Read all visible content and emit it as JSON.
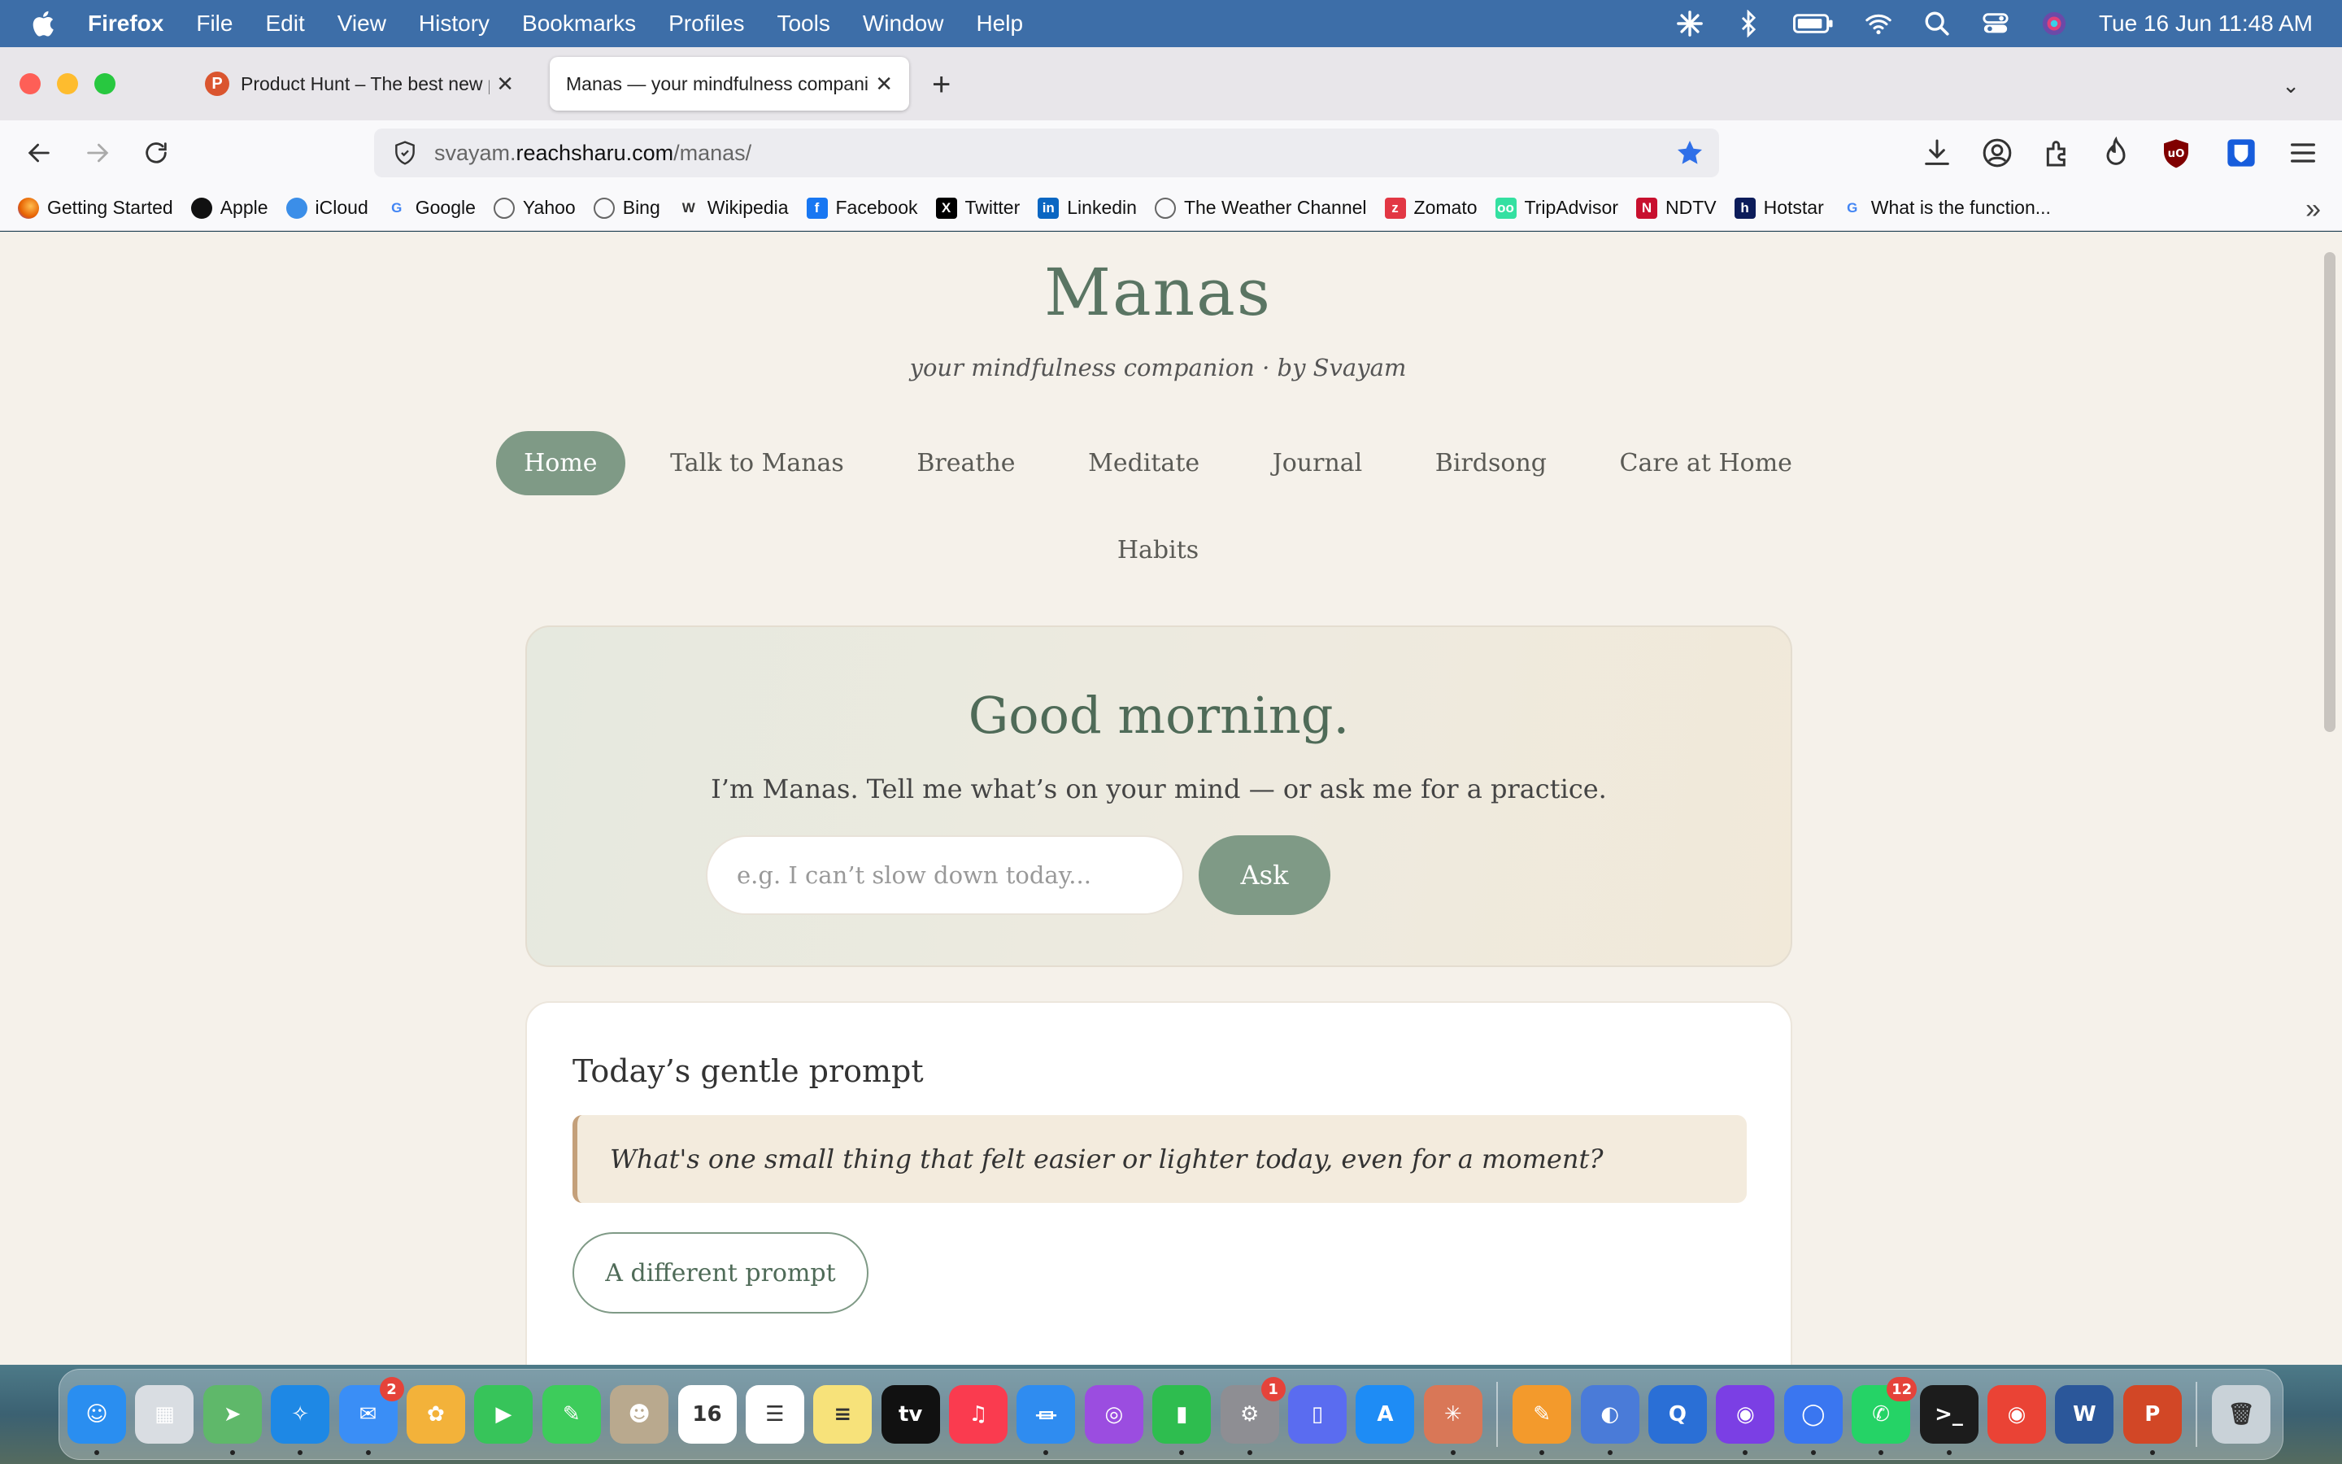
{
  "menubar": {
    "app": "Firefox",
    "items": [
      "File",
      "Edit",
      "View",
      "History",
      "Bookmarks",
      "Profiles",
      "Tools",
      "Window",
      "Help"
    ],
    "datetime": "Tue 16 Jun  11:48 AM"
  },
  "tabs": [
    {
      "title": "Product Hunt – The best new pr",
      "favicon": "P"
    },
    {
      "title": "Manas — your mindfulness compani"
    }
  ],
  "url": {
    "prefix": "svayam.",
    "host": "reachsharu.com",
    "path": "/manas/"
  },
  "bookmarks": [
    {
      "label": "Getting Started",
      "icon": "firefox-icon",
      "color": "#e66000",
      "glyph": ""
    },
    {
      "label": "Apple",
      "icon": "apple-icon",
      "color": "#111111",
      "glyph": ""
    },
    {
      "label": "iCloud",
      "icon": "cloud-icon",
      "color": "#3b8ee8",
      "glyph": ""
    },
    {
      "label": "Google",
      "icon": "google-icon",
      "color": "#4285f4",
      "glyph": "G"
    },
    {
      "label": "Yahoo",
      "icon": "globe-icon",
      "color": "#666666",
      "glyph": ""
    },
    {
      "label": "Bing",
      "icon": "globe-icon",
      "color": "#666666",
      "glyph": ""
    },
    {
      "label": "Wikipedia",
      "icon": "wikipedia-icon",
      "color": "#333333",
      "glyph": "W"
    },
    {
      "label": "Facebook",
      "icon": "facebook-icon",
      "color": "#1877f2",
      "glyph": "f"
    },
    {
      "label": "Twitter",
      "icon": "x-icon",
      "color": "#000000",
      "glyph": "X"
    },
    {
      "label": "Linkedin",
      "icon": "linkedin-icon",
      "color": "#0a66c2",
      "glyph": "in"
    },
    {
      "label": "The Weather Channel",
      "icon": "globe-icon",
      "color": "#666666",
      "glyph": ""
    },
    {
      "label": "Zomato",
      "icon": "zomato-icon",
      "color": "#e23744",
      "glyph": "z"
    },
    {
      "label": "TripAdvisor",
      "icon": "tripadvisor-icon",
      "color": "#34e0a1",
      "glyph": "oo"
    },
    {
      "label": "NDTV",
      "icon": "ndtv-icon",
      "color": "#c8102e",
      "glyph": "N"
    },
    {
      "label": "Hotstar",
      "icon": "hotstar-icon",
      "color": "#0c1c5a",
      "glyph": "h"
    },
    {
      "label": "What is the function...",
      "icon": "google-icon",
      "color": "#4285f4",
      "glyph": "G"
    }
  ],
  "site": {
    "brand": "Manas",
    "tagline": "your mindfulness companion · by Svayam",
    "nav": [
      "Home",
      "Talk to Manas",
      "Breathe",
      "Meditate",
      "Journal",
      "Birdsong",
      "Care at Home"
    ],
    "nav_row2": "Habits",
    "hero": {
      "greeting": "Good morning.",
      "subtitle": "I’m Manas. Tell me what’s on your mind — or ask me for a practice.",
      "input_placeholder": "e.g. I can’t slow down today...",
      "ask_label": "Ask"
    },
    "prompt": {
      "heading": "Today’s gentle prompt",
      "text": "What's one small thing that felt easier or lighter today, even for a moment?",
      "button_label": "A different prompt"
    }
  },
  "dock": [
    {
      "name": "finder-icon",
      "color": "#2a8ef0",
      "glyph": "☺",
      "dot": true
    },
    {
      "name": "launchpad-icon",
      "color": "#d9dde2",
      "glyph": "▦"
    },
    {
      "name": "maps-icon",
      "color": "#5fb86a",
      "glyph": "➤",
      "dot": true
    },
    {
      "name": "safari-icon",
      "color": "#1e88e5",
      "glyph": "✧",
      "dot": true
    },
    {
      "name": "mail-icon",
      "color": "#3a8ef6",
      "glyph": "✉",
      "dot": true,
      "badge": "2"
    },
    {
      "name": "photos-icon",
      "color": "#f3b23a",
      "glyph": "✿"
    },
    {
      "name": "facetime-icon",
      "color": "#37c45a",
      "glyph": "▶"
    },
    {
      "name": "messages-icon",
      "color": "#3dcc5b",
      "glyph": "✎"
    },
    {
      "name": "contacts-icon",
      "color": "#b9a98e",
      "glyph": "☻"
    },
    {
      "name": "calendar-icon",
      "color": "#ffffff",
      "glyph": "16",
      "dark": true
    },
    {
      "name": "reminders-icon",
      "color": "#ffffff",
      "glyph": "☰",
      "dark": true
    },
    {
      "name": "notes-icon",
      "color": "#f7e27a",
      "glyph": "≡",
      "dark": true
    },
    {
      "name": "apple-tv-icon",
      "color": "#111111",
      "glyph": "tv"
    },
    {
      "name": "music-icon",
      "color": "#fa3b4f",
      "glyph": "♫"
    },
    {
      "name": "keynote-icon",
      "color": "#2f8cf0",
      "glyph": "⏛",
      "dot": true
    },
    {
      "name": "podcasts-icon",
      "color": "#9b4de0",
      "glyph": "◎"
    },
    {
      "name": "numbers-icon",
      "color": "#2ebd4f",
      "glyph": "▮",
      "dot": true
    },
    {
      "name": "system-settings-icon",
      "color": "#8e8e93",
      "glyph": "⚙",
      "dot": true,
      "badge": "1"
    },
    {
      "name": "iphone-mirroring-icon",
      "color": "#5a6cf0",
      "glyph": "▯"
    },
    {
      "name": "app-store-icon",
      "color": "#1e8cf5",
      "glyph": "A"
    },
    {
      "name": "claude-icon",
      "color": "#d97757",
      "glyph": "✳",
      "dot": true
    },
    {
      "name": "separator"
    },
    {
      "name": "pages-icon",
      "color": "#f39a2c",
      "glyph": "✎",
      "dot": true
    },
    {
      "name": "stickies-icon",
      "color": "#4a7bd8",
      "glyph": "◐",
      "dot": true
    },
    {
      "name": "quicktime-icon",
      "color": "#2a6fd6",
      "glyph": "Q"
    },
    {
      "name": "firefox-icon",
      "color": "#7b3fe4",
      "glyph": "◉",
      "dot": true
    },
    {
      "name": "signal-icon",
      "color": "#3a76f0",
      "glyph": "◯",
      "dot": true
    },
    {
      "name": "whatsapp-icon",
      "color": "#25d366",
      "glyph": "✆",
      "dot": true,
      "badge": "12"
    },
    {
      "name": "terminal-icon",
      "color": "#1c1c1c",
      "glyph": ">_",
      "dot": true
    },
    {
      "name": "chrome-icon",
      "color": "#ea4335",
      "glyph": "◉"
    },
    {
      "name": "word-icon",
      "color": "#2b579a",
      "glyph": "W"
    },
    {
      "name": "powerpoint-icon",
      "color": "#d24726",
      "glyph": "P",
      "dot": true
    },
    {
      "name": "separator"
    },
    {
      "name": "trash-icon",
      "color": "#c9d2d8",
      "glyph": "🗑",
      "dark": true
    }
  ]
}
